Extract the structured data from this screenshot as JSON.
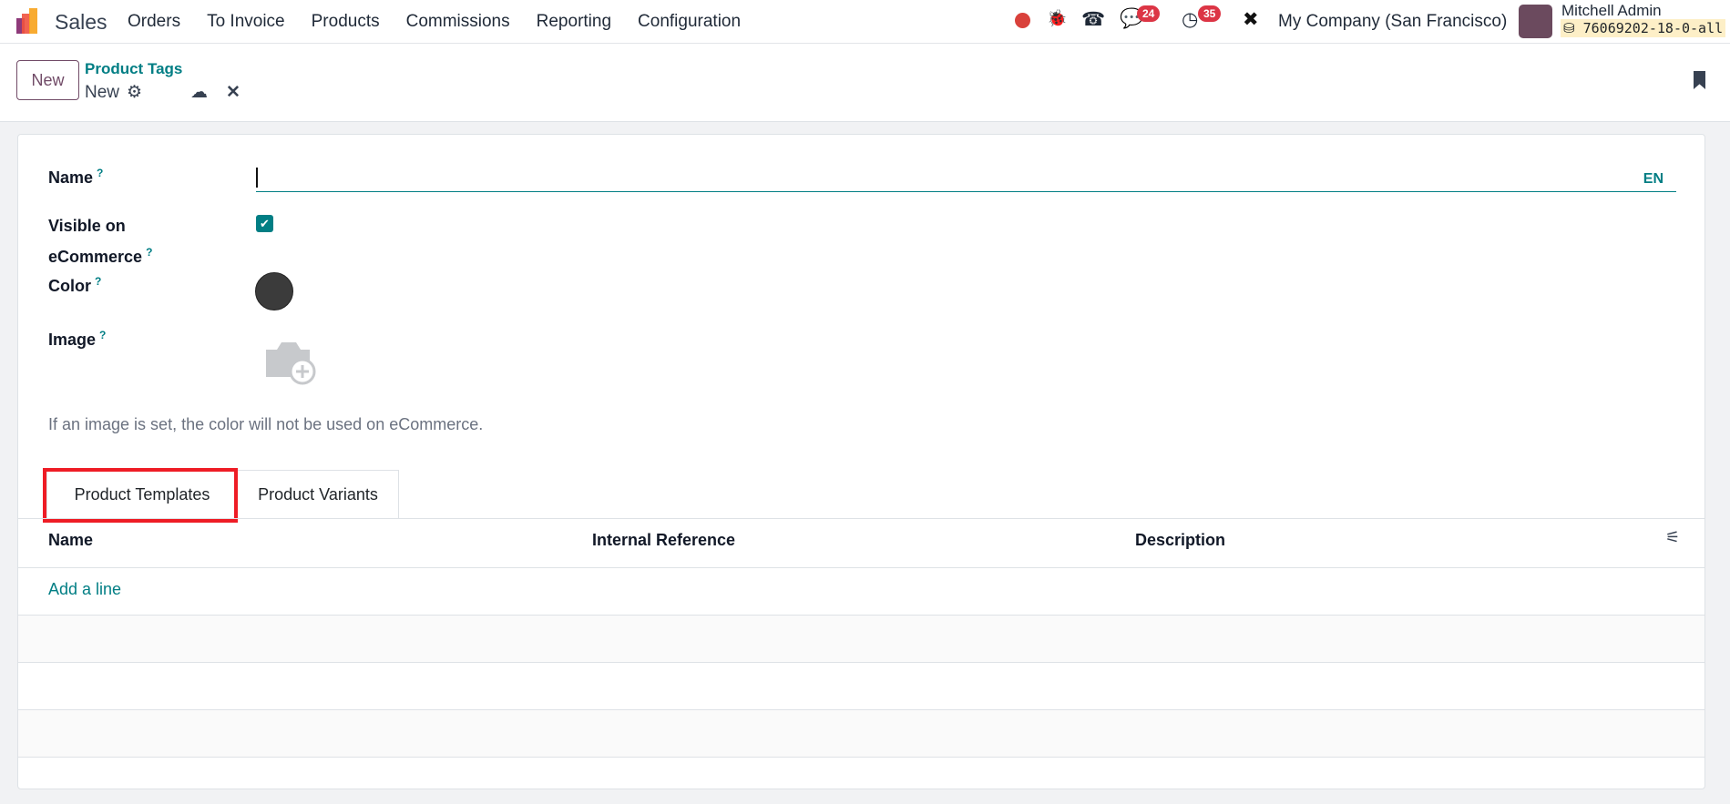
{
  "navbar": {
    "app_name": "Sales",
    "menu": [
      "Orders",
      "To Invoice",
      "Products",
      "Commissions",
      "Reporting",
      "Configuration"
    ],
    "messages_count": "24",
    "activities_count": "35",
    "company": "My Company (San Francisco)",
    "user_name": "Mitchell Admin",
    "database": "76069202-18-0-all"
  },
  "control_panel": {
    "new_label": "New",
    "breadcrumb": "Product Tags",
    "record_name": "New"
  },
  "form": {
    "name_label": "Name",
    "name_value": "",
    "lang": "EN",
    "visible_label_1": "Visible on",
    "visible_label_2": "eCommerce",
    "visible_checked": true,
    "color_label": "Color",
    "color_value": "#3b3b3b",
    "image_label": "Image",
    "help_mark": "?",
    "image_help": "If an image is set, the color will not be used on eCommerce."
  },
  "tabs": [
    {
      "label": "Product Templates",
      "active": true
    },
    {
      "label": "Product Variants",
      "active": false
    }
  ],
  "table": {
    "columns": [
      "Name",
      "Internal Reference",
      "Description"
    ],
    "add_line": "Add a line"
  }
}
